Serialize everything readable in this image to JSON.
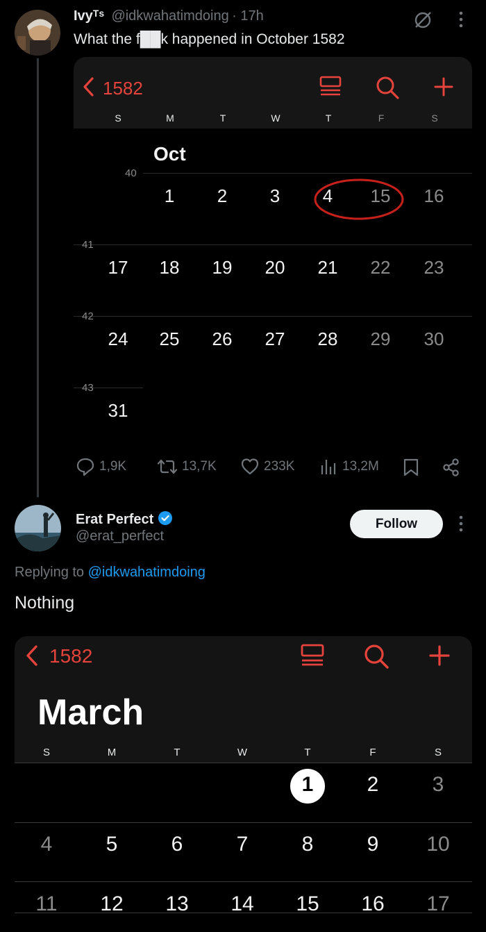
{
  "tweet": {
    "display_name": "Ivyᵀˢ",
    "handle": "@idkwahatimdoing",
    "time": "· 17h",
    "text": "What the f██k happened in October 1582",
    "stats": {
      "replies": "1,9K",
      "retweets": "13,7K",
      "likes": "233K",
      "views": "13,2M"
    }
  },
  "calendar_oct": {
    "year_back": "1582",
    "weekdays": [
      "S",
      "M",
      "T",
      "W",
      "T",
      "F",
      "S"
    ],
    "month": "Oct",
    "weeks": [
      {
        "number": "40",
        "days": [
          "",
          "1",
          "2",
          "3",
          "4",
          "15",
          "16"
        ]
      },
      {
        "number": "41",
        "days": [
          "17",
          "18",
          "19",
          "20",
          "21",
          "22",
          "23"
        ]
      },
      {
        "number": "42",
        "days": [
          "24",
          "25",
          "26",
          "27",
          "28",
          "29",
          "30"
        ]
      },
      {
        "number": "43",
        "days": [
          "31",
          "",
          "",
          "",
          "",
          "",
          ""
        ]
      }
    ]
  },
  "reply": {
    "display_name": "Erat Perfect",
    "handle": "@erat_perfect",
    "follow_label": "Follow",
    "replying_prefix": "Replying to",
    "replying_handle": "@idkwahatimdoing",
    "text": "Nothing"
  },
  "calendar_mar": {
    "year_back": "1582",
    "month": "March",
    "weekdays": [
      "S",
      "M",
      "T",
      "W",
      "T",
      "F",
      "S"
    ],
    "weeks": [
      [
        "",
        "",
        "",
        "",
        "1",
        "2",
        "3"
      ],
      [
        "4",
        "5",
        "6",
        "7",
        "8",
        "9",
        "10"
      ],
      [
        "11",
        "12",
        "13",
        "14",
        "15",
        "16",
        "17"
      ]
    ],
    "today": "1"
  },
  "colors": {
    "accent_red": "#e5433b",
    "verified_blue": "#1d9bf0",
    "link_blue": "#1d9bf0"
  }
}
